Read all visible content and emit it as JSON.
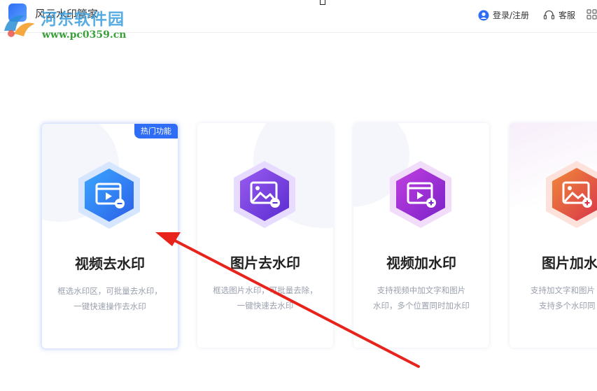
{
  "header": {
    "app_title": "风云水印管家",
    "login_label": "登录/注册",
    "service_label": "客服"
  },
  "watermark": {
    "site_name": "河东软件园",
    "site_url": "www.pc0359.cn"
  },
  "colors": {
    "primary": "#2f6df6",
    "arrow": "#e8231c"
  },
  "cards": [
    {
      "title": "视频去水印",
      "desc_line1": "框选水印区，可批量去水印，",
      "desc_line2": "一键快速操作去水印",
      "badge": "热门功能",
      "icon": "video-remove-icon"
    },
    {
      "title": "图片去水印",
      "desc_line1": "框选图片水印，可批量去除，",
      "desc_line2": "一键快速去水印",
      "icon": "image-remove-icon"
    },
    {
      "title": "视频加水印",
      "desc_line1": "支持视频中加文字和图片",
      "desc_line2": "水印，多个位置同时加水印",
      "icon": "video-add-icon"
    },
    {
      "title": "图片加水印",
      "desc_line1": "支持加文字和图片",
      "desc_line2": "支持多个水印同",
      "icon": "image-add-icon"
    }
  ]
}
